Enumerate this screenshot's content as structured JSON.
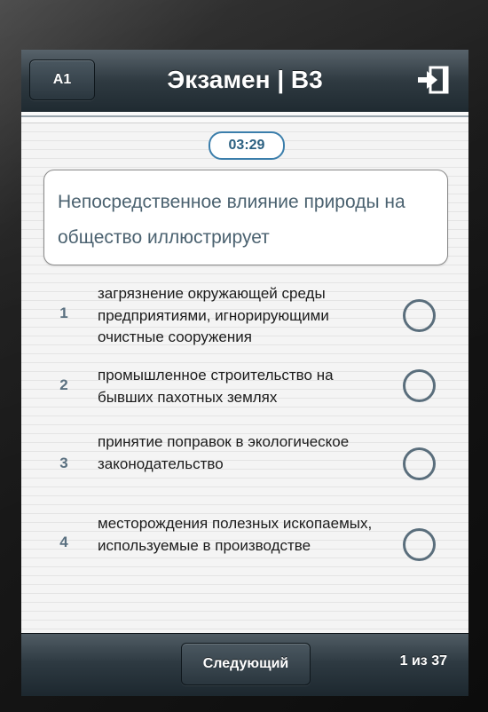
{
  "header": {
    "left_button_label": "A1",
    "title": "Экзамен | B3",
    "exit_icon": "exit-icon"
  },
  "timer": {
    "value": "03:29"
  },
  "question": {
    "text": "Непосредственное влияние природы на общество иллюстрирует"
  },
  "answers": [
    {
      "number": "1",
      "text": "загрязнение окружающей среды предприятиями, игнорирующими очистные сооружения",
      "selected": false
    },
    {
      "number": "2",
      "text": "промышленное строительство на бывших пахотных землях",
      "selected": false
    },
    {
      "number": "3",
      "text": "принятие поправок в экологическое законодательство",
      "selected": false
    },
    {
      "number": "4",
      "text": "месторождения полезных ископаемых, используемые в производстве",
      "selected": false
    }
  ],
  "footer": {
    "next_button_label": "Следующий",
    "counter": "1 из 37"
  },
  "colors": {
    "accent": "#3b7eab",
    "bar_dark": "#2f3a41",
    "radio": "#5a6e7c"
  }
}
